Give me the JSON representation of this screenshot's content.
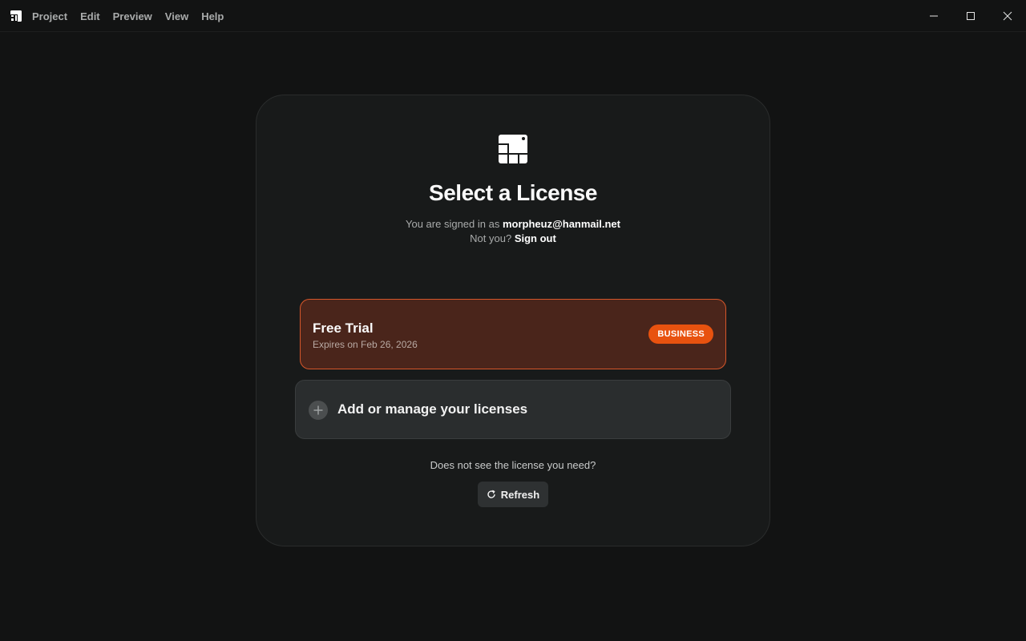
{
  "menu": {
    "items": [
      "Project",
      "Edit",
      "Preview",
      "View",
      "Help"
    ]
  },
  "window_controls": {
    "icons": [
      "minimize-icon",
      "maximize-icon",
      "close-icon"
    ]
  },
  "dialog": {
    "title": "Select a License",
    "signed_in_prefix": "You are signed in as",
    "email": "morpheuz@hanmail.net",
    "not_you": "Not you?",
    "sign_out": "Sign out",
    "license": {
      "name": "Free Trial",
      "expires": "Expires on Feb 26, 2026",
      "badge": "BUSINESS",
      "selected": true
    },
    "manage_label": "Add or manage your licenses",
    "hint": "Does not see the license you need?",
    "refresh_label": "Refresh"
  },
  "colors": {
    "background": "#121313",
    "card": "#181a1a",
    "license_bg": "#4a251b",
    "license_border": "#d5562a",
    "badge": "#e8520f"
  }
}
